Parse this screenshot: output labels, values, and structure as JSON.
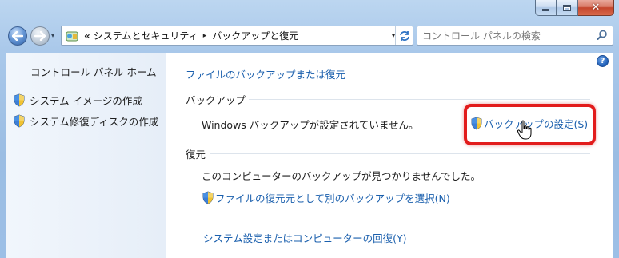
{
  "window": {
    "caption_buttons": {
      "minimize": "–",
      "maximize": "□",
      "close": "✕"
    }
  },
  "nav": {
    "back_icon": "back-arrow-icon",
    "forward_icon": "forward-arrow-icon",
    "breadcrumb_overflow": "«",
    "breadcrumbs": [
      "システムとセキュリティ",
      "バックアップと復元"
    ],
    "breadcrumb_separator": "▸",
    "dropdown_glyph": "▾",
    "refresh_glyph": "↻"
  },
  "search": {
    "placeholder": "コントロール パネルの検索"
  },
  "sidebar": {
    "home": "コントロール パネル ホーム",
    "items": [
      {
        "label": "システム イメージの作成",
        "icon": "uac-shield-icon"
      },
      {
        "label": "システム修復ディスクの作成",
        "icon": "uac-shield-icon"
      }
    ]
  },
  "main": {
    "help_glyph": "?",
    "heading_link": "ファイルのバックアップまたは復元",
    "backup": {
      "title": "バックアップ",
      "status": "Windows バックアップが設定されていません。",
      "setup_link": "バックアップの設定(S)"
    },
    "restore": {
      "title": "復元",
      "status": "このコンピューターのバックアップが見つかりませんでした。",
      "select_link": "ファイルの復元元として別のバックアップを選択(N)",
      "recover_link": "システム設定またはコンピューターの回復(Y)"
    }
  },
  "colors": {
    "link": "#1a5fad",
    "highlight": "#e21c1c",
    "sidebar_bg": "#eaf1fa"
  }
}
